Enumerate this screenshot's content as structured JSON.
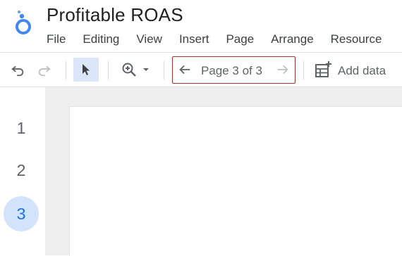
{
  "app": {
    "title": "Profitable ROAS",
    "logo_icon": "looker-studio-logo-icon"
  },
  "menu": {
    "items": [
      {
        "label": "File"
      },
      {
        "label": "Editing"
      },
      {
        "label": "View"
      },
      {
        "label": "Insert"
      },
      {
        "label": "Page"
      },
      {
        "label": "Arrange"
      },
      {
        "label": "Resource"
      }
    ]
  },
  "toolbar": {
    "undo_icon": "undo-icon",
    "redo_icon": "redo-icon",
    "select_icon": "pointer-icon",
    "zoom_icon": "zoom-in-icon",
    "zoom_dropdown_icon": "caret-down-icon",
    "prev_icon": "arrow-left-icon",
    "next_icon": "arrow-right-icon",
    "page_label": "Page 3 of 3",
    "add_data_icon": "add-data-icon",
    "add_data_label": "Add data"
  },
  "pages": {
    "items": [
      {
        "label": "1"
      },
      {
        "label": "2"
      },
      {
        "label": "3"
      }
    ],
    "current": "3"
  },
  "colors": {
    "accent": "#1a73e8",
    "active_page_bg": "#d2e3fc",
    "page_nav_border": "#a93232",
    "select_bg": "#dbe7f8"
  }
}
